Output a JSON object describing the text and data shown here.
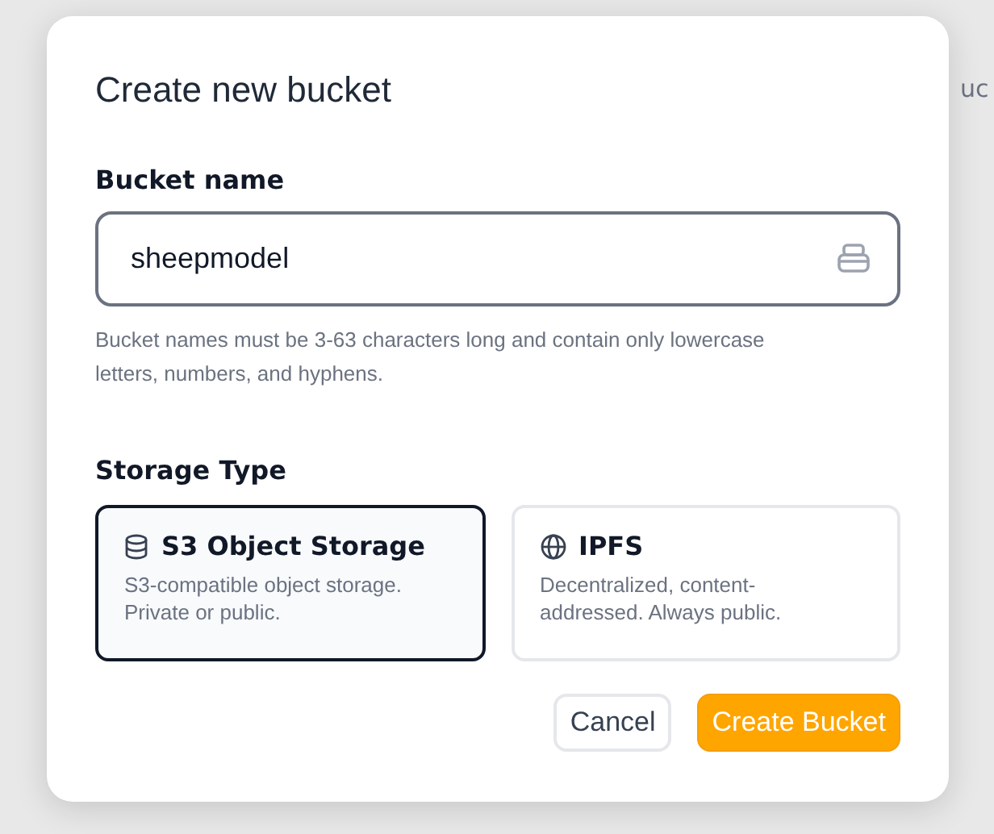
{
  "background": {
    "text": "uc"
  },
  "dialog": {
    "title": "Create new bucket",
    "bucket_name": {
      "label": "Bucket name",
      "value": "sheepmodel",
      "hint": "Bucket names must be 3-63 characters long and contain only lowercase letters, numbers, and hyphens."
    },
    "storage_type": {
      "label": "Storage Type",
      "options": [
        {
          "kind": "database",
          "title": "S3 Object Storage",
          "description": "S3-compatible object storage. Private or public.",
          "selected": true
        },
        {
          "kind": "globe",
          "title": "IPFS",
          "description": "Decentralized, content-addressed. Always public.",
          "selected": false
        }
      ]
    },
    "buttons": [
      {
        "kind": "secondary",
        "label": "Cancel"
      },
      {
        "kind": "primary",
        "label": "Create Bucket"
      }
    ]
  }
}
